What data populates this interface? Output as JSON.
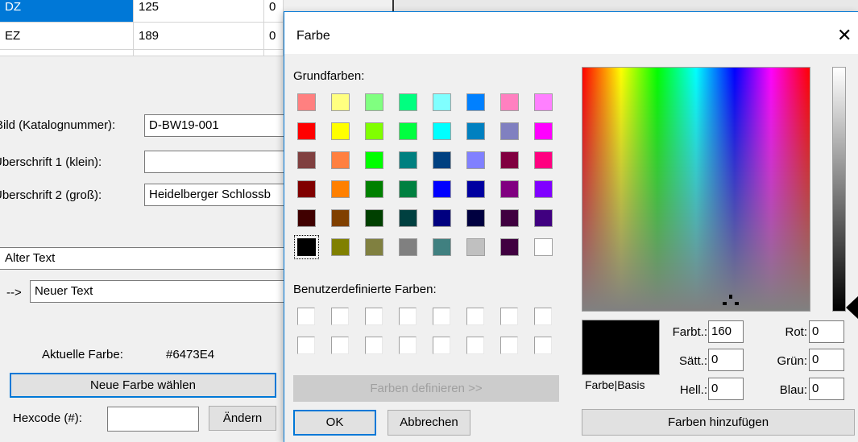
{
  "background_app": {
    "grid_rows": [
      {
        "code": "DZ",
        "price": "125",
        "extra": "0"
      },
      {
        "code": "EZ",
        "price": "189",
        "extra": "0"
      }
    ],
    "fields": {
      "bild_label": "Bild (Katalognummer):",
      "bild_value": "D-BW19-001",
      "ueberschrift1_label": "Überschrift 1 (klein):",
      "ueberschrift1_value": "",
      "ueberschrift2_label": "Überschrift 2 (groß):",
      "ueberschrift2_value": "Heidelberger Schlossb"
    },
    "alter_text": "Alter Text",
    "arrow": "-->",
    "neuer_text": "Neuer Text",
    "aktuelle_farbe_label": "Aktuelle Farbe:",
    "aktuelle_farbe_value": "#6473E4",
    "neue_farbe_button": "Neue Farbe wählen",
    "hexcode_label": "Hexcode (#):",
    "hexcode_value": "",
    "aendern_button": "Ändern"
  },
  "dialog": {
    "title": "Farbe",
    "close_glyph": "✕",
    "grundfarben_label": "Grundfarben:",
    "basic_colors": [
      [
        "#ff8080",
        "#ffff80",
        "#80ff80",
        "#00ff80",
        "#80ffff",
        "#0080ff",
        "#ff80c0",
        "#ff80ff"
      ],
      [
        "#ff0000",
        "#ffff00",
        "#80ff00",
        "#00ff40",
        "#00ffff",
        "#0080c0",
        "#8080c0",
        "#ff00ff"
      ],
      [
        "#804040",
        "#ff8040",
        "#00ff00",
        "#008080",
        "#004080",
        "#8080ff",
        "#800040",
        "#ff0080"
      ],
      [
        "#800000",
        "#ff8000",
        "#008000",
        "#008040",
        "#0000ff",
        "#0000a0",
        "#800080",
        "#8000ff"
      ],
      [
        "#400000",
        "#804000",
        "#004000",
        "#004040",
        "#000080",
        "#000040",
        "#400040",
        "#400080"
      ],
      [
        "#000000",
        "#808000",
        "#808040",
        "#808080",
        "#408080",
        "#c0c0c0",
        "#400040",
        "#ffffff"
      ]
    ],
    "benutzer_label": "Benutzerdefinierte Farben:",
    "farben_definieren_button": "Farben definieren >>",
    "ok_button": "OK",
    "abbrechen_button": "Abbrechen",
    "farbe_basis_label": "Farbe|Basis",
    "selected_color": "#000000",
    "farbt_label": "Farbt.:",
    "farbt_value": "160",
    "saett_label": "Sätt.:",
    "saett_value": "0",
    "hell_label": "Hell.:",
    "hell_value": "0",
    "rot_label": "Rot:",
    "rot_value": "0",
    "gruen_label": "Grün:",
    "gruen_value": "0",
    "blau_label": "Blau:",
    "blau_value": "0",
    "farben_hinzufuegen_button": "Farben hinzufügen"
  }
}
